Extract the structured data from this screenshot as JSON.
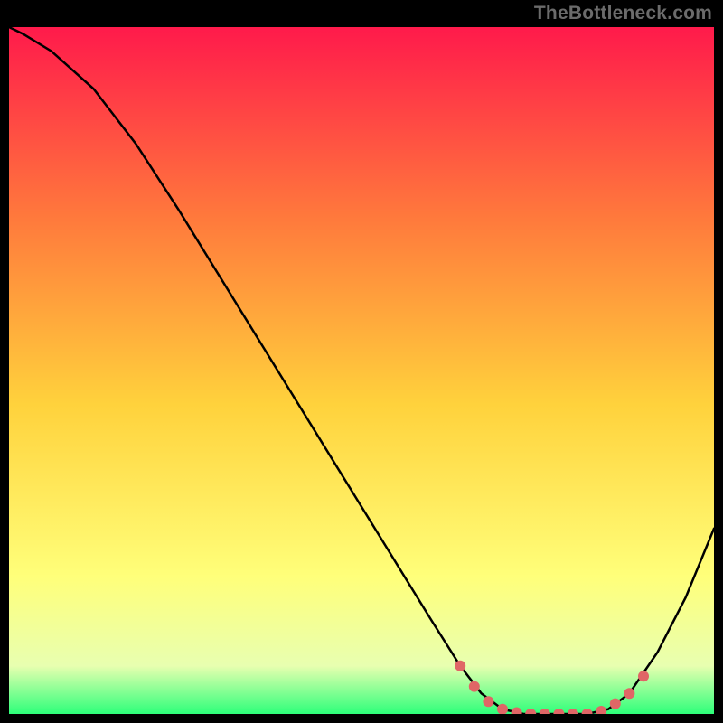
{
  "watermark": "TheBottleneck.com",
  "chart_data": {
    "type": "line",
    "title": "",
    "xlabel": "",
    "ylabel": "",
    "xlim": [
      0,
      100
    ],
    "ylim": [
      0,
      100
    ],
    "gradient_colors": {
      "top": "#ff1a4b",
      "mid1": "#ff7a3c",
      "mid2": "#ffd23c",
      "mid3": "#ffff7a",
      "mid4": "#e8ffb0",
      "bottom": "#2dff7a"
    },
    "series": [
      {
        "name": "curve",
        "type": "line",
        "stroke": "#000000",
        "points": [
          {
            "x": 0.0,
            "y": 100.0
          },
          {
            "x": 2.0,
            "y": 99.0
          },
          {
            "x": 6.0,
            "y": 96.5
          },
          {
            "x": 12.0,
            "y": 91.0
          },
          {
            "x": 18.0,
            "y": 83.0
          },
          {
            "x": 24.0,
            "y": 73.5
          },
          {
            "x": 30.0,
            "y": 63.5
          },
          {
            "x": 36.0,
            "y": 53.5
          },
          {
            "x": 42.0,
            "y": 43.5
          },
          {
            "x": 48.0,
            "y": 33.5
          },
          {
            "x": 54.0,
            "y": 23.5
          },
          {
            "x": 60.0,
            "y": 13.5
          },
          {
            "x": 64.0,
            "y": 7.0
          },
          {
            "x": 67.0,
            "y": 3.0
          },
          {
            "x": 70.0,
            "y": 0.7
          },
          {
            "x": 73.0,
            "y": 0.0
          },
          {
            "x": 78.0,
            "y": 0.0
          },
          {
            "x": 82.0,
            "y": 0.0
          },
          {
            "x": 85.0,
            "y": 0.7
          },
          {
            "x": 88.0,
            "y": 3.0
          },
          {
            "x": 92.0,
            "y": 9.0
          },
          {
            "x": 96.0,
            "y": 17.0
          },
          {
            "x": 100.0,
            "y": 27.0
          }
        ]
      },
      {
        "name": "markers",
        "type": "scatter",
        "fill": "#e06666",
        "points": [
          {
            "x": 64.0,
            "y": 7.0
          },
          {
            "x": 66.0,
            "y": 4.0
          },
          {
            "x": 68.0,
            "y": 1.8
          },
          {
            "x": 70.0,
            "y": 0.7
          },
          {
            "x": 72.0,
            "y": 0.2
          },
          {
            "x": 74.0,
            "y": 0.0
          },
          {
            "x": 76.0,
            "y": 0.0
          },
          {
            "x": 78.0,
            "y": 0.0
          },
          {
            "x": 80.0,
            "y": 0.0
          },
          {
            "x": 82.0,
            "y": 0.0
          },
          {
            "x": 84.0,
            "y": 0.4
          },
          {
            "x": 86.0,
            "y": 1.5
          },
          {
            "x": 88.0,
            "y": 3.0
          },
          {
            "x": 90.0,
            "y": 5.5
          }
        ]
      }
    ]
  }
}
